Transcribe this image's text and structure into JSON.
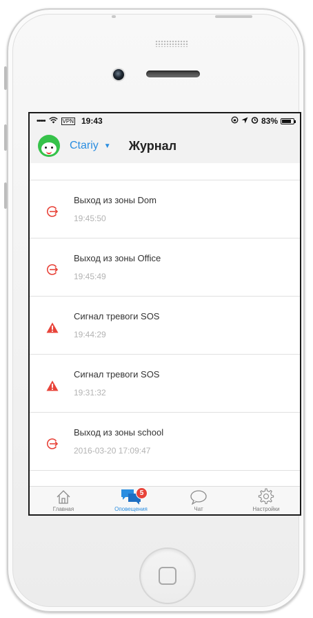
{
  "status_bar": {
    "signal": "•••••",
    "vpn": "VPN",
    "time": "19:43",
    "battery_percent": "83%",
    "battery_level": 0.83
  },
  "header": {
    "account_name": "Ctariy",
    "title": "Журнал"
  },
  "events": [
    {
      "icon": "exit-zone-icon",
      "title": "Выход из зоны  Dom",
      "time": "19:45:50"
    },
    {
      "icon": "exit-zone-icon",
      "title": "Выход из зоны  Office",
      "time": "19:45:49"
    },
    {
      "icon": "warning-icon",
      "title": "Сигнал тревоги SOS",
      "time": "19:44:29"
    },
    {
      "icon": "warning-icon",
      "title": "Сигнал тревоги SOS",
      "time": "19:31:32"
    },
    {
      "icon": "exit-zone-icon",
      "title": "Выход из зоны  school",
      "time": "2016-03-20 17:09:47"
    }
  ],
  "tabs": [
    {
      "label": "Главная",
      "icon": "home-icon",
      "active": false
    },
    {
      "label": "Оповещения",
      "icon": "chat-bubbles-icon",
      "active": true,
      "badge": "5"
    },
    {
      "label": "Чат",
      "icon": "speech-bubble-icon",
      "active": false
    },
    {
      "label": "Настройки",
      "icon": "gear-icon",
      "active": false
    }
  ],
  "colors": {
    "accent": "#2a8de0",
    "alert_red": "#e8443a",
    "avatar_green": "#36c24a"
  }
}
